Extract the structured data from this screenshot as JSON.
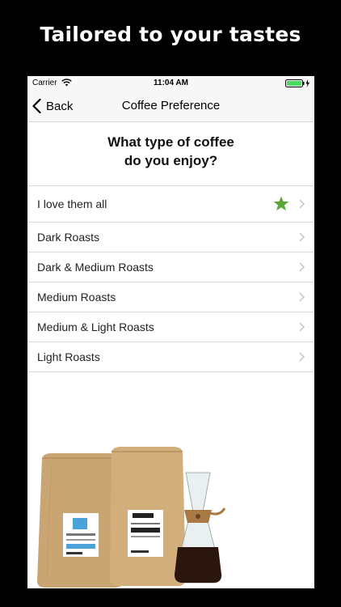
{
  "promo": {
    "title": "Tailored to your tastes"
  },
  "status_bar": {
    "carrier": "Carrier",
    "time": "11:04 AM"
  },
  "nav": {
    "back_label": "Back",
    "title": "Coffee Preference"
  },
  "question": {
    "line1": "What type of coffee",
    "line2": "do you enjoy?"
  },
  "options": [
    {
      "label": "I love them all",
      "selected": true
    },
    {
      "label": "Dark Roasts",
      "selected": false
    },
    {
      "label": "Dark & Medium Roasts",
      "selected": false
    },
    {
      "label": "Medium Roasts",
      "selected": false
    },
    {
      "label": "Medium & Light Roasts",
      "selected": false
    },
    {
      "label": "Light Roasts",
      "selected": false
    }
  ],
  "colors": {
    "star": "#5aa83a",
    "chevron": "#c4c4c8",
    "battery": "#4cd964"
  },
  "icons": [
    "wifi-icon",
    "battery-icon",
    "back-chevron-icon",
    "star-icon",
    "chevron-right-icon"
  ]
}
